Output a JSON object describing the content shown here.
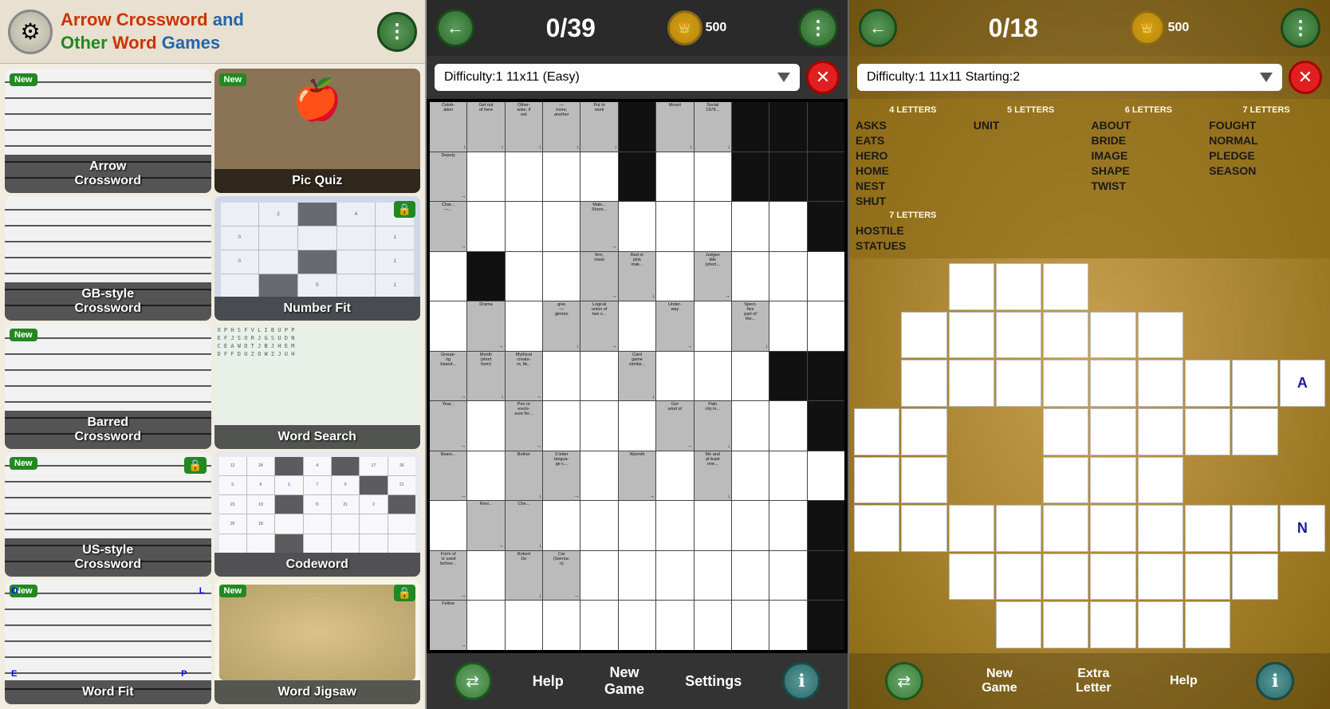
{
  "panel_menu": {
    "header": {
      "title_line1": "Arrow Crossword and",
      "title_line2": "Other Word Games"
    },
    "items": [
      {
        "id": "arrow-crossword",
        "label": "Arrow\nCrossword",
        "label_l1": "Arrow",
        "label_l2": "Crossword",
        "new": true,
        "lock": false,
        "col": 0
      },
      {
        "id": "pic-quiz",
        "label": "Pic Quiz",
        "new": true,
        "lock": false,
        "col": 1
      },
      {
        "id": "gb-crossword",
        "label": "GB-style\nCrossword",
        "label_l1": "GB-style",
        "label_l2": "Crossword",
        "new": false,
        "lock": false,
        "col": 0
      },
      {
        "id": "number-fit",
        "label": "Number Fit",
        "new": false,
        "lock": true,
        "col": 1
      },
      {
        "id": "barred-crossword",
        "label": "Barred\nCrossword",
        "label_l1": "Barred",
        "label_l2": "Crossword",
        "new": true,
        "lock": false,
        "col": 0
      },
      {
        "id": "word-search",
        "label": "Word Search",
        "new": false,
        "lock": false,
        "col": 1
      },
      {
        "id": "us-crossword",
        "label": "US-style\nCrossword",
        "label_l1": "US-style",
        "label_l2": "Crossword",
        "new": true,
        "lock": true,
        "col": 0
      },
      {
        "id": "codeword",
        "label": "Codeword",
        "new": false,
        "lock": false,
        "col": 1
      },
      {
        "id": "word-fit",
        "label": "Word Fit",
        "new": true,
        "lock": false,
        "col": 0
      },
      {
        "id": "word-jigsaw",
        "label": "Word Jigsaw",
        "new": true,
        "lock": true,
        "col": 1
      }
    ]
  },
  "panel_game": {
    "score": "0/39",
    "coins": "500",
    "difficulty": "Difficulty:1  11x11  (Easy)",
    "footer": {
      "help": "Help",
      "new_game": "New\nGame",
      "new_game_l1": "New",
      "new_game_l2": "Game",
      "settings": "Settings"
    },
    "clues": [
      {
        "r": 0,
        "c": 0,
        "text": "Celeb-\nation",
        "arrow": "↓"
      },
      {
        "r": 0,
        "c": 1,
        "text": "Get out\nof here",
        "arrow": "↓"
      },
      {
        "r": 0,
        "c": 2,
        "text": "Other-\nwise, if\nnot",
        "arrow": "↓"
      },
      {
        "r": 0,
        "c": 3,
        "text": "—\nmore,\nanother",
        "arrow": "↓"
      },
      {
        "r": 0,
        "c": 4,
        "text": "Put to\nwork",
        "arrow": "↓"
      },
      {
        "r": 0,
        "c": 6,
        "text": "Mount",
        "arrow": "↓"
      },
      {
        "r": 0,
        "c": 7,
        "text": "Social\n1978...",
        "arrow": "↓"
      },
      {
        "r": 1,
        "c": 0,
        "text": "Deputy",
        "arrow": "→"
      },
      {
        "r": 2,
        "c": 0,
        "text": "Char...",
        "arrow": "→"
      },
      {
        "r": 2,
        "c": 4,
        "text": "Male...\nShore...",
        "arrow": "→"
      },
      {
        "r": 3,
        "c": 4,
        "text": "firm,\ninsist",
        "arrow": "→"
      },
      {
        "r": 3,
        "c": 5,
        "text": "Red or\npink\nmak...",
        "arrow": "↓"
      },
      {
        "r": 3,
        "c": 6,
        "text": "Judges\ntitle\n(short...",
        "arrow": "→"
      },
      {
        "r": 4,
        "c": 1,
        "text": "Drama",
        "arrow": "→"
      },
      {
        "r": 4,
        "c": 3,
        "text": "give\n—\ngimmo",
        "arrow": "↓"
      },
      {
        "r": 4,
        "c": 4,
        "text": "Logical\nunion of\ntwo s...",
        "arrow": "→"
      },
      {
        "r": 4,
        "c": 5,
        "text": "Under-\nway",
        "arrow": "→"
      },
      {
        "r": 4,
        "c": 7,
        "text": "Speci-\nfies\npart of\nthe...",
        "arrow": "↓"
      },
      {
        "r": 5,
        "c": 0,
        "text": "Groupi-\nng\nbased...",
        "arrow": "→"
      },
      {
        "r": 5,
        "c": 1,
        "text": "Month\n(short\nform)",
        "arrow": "↓"
      },
      {
        "r": 5,
        "c": 2,
        "text": "Mythical\ncreatu-\nre, lik...",
        "arrow": "→"
      },
      {
        "r": 5,
        "c": 5,
        "text": "Card\ngame\nsimilar...",
        "arrow": "↓"
      },
      {
        "r": 6,
        "c": 0,
        "text": "Year...",
        "arrow": "→"
      },
      {
        "r": 6,
        "c": 2,
        "text": "Pen or\nenclo-\nsure for...",
        "arrow": "→"
      },
      {
        "r": 6,
        "c": 6,
        "text": "Get\nwind of",
        "arrow": "→"
      },
      {
        "r": 6,
        "c": 7,
        "text": "Palo\ncity in...",
        "arrow": "↓"
      },
      {
        "r": 7,
        "c": 0,
        "text": "Beam...",
        "arrow": "→"
      },
      {
        "r": 7,
        "c": 2,
        "text": "Bother",
        "arrow": "↓"
      },
      {
        "r": 7,
        "c": 3,
        "text": "3 letter\nlangua-\nge c...",
        "arrow": "→"
      },
      {
        "r": 7,
        "c": 5,
        "text": "Warmth",
        "arrow": "→"
      },
      {
        "r": 7,
        "c": 7,
        "text": "Me and\nat least\none...",
        "arrow": "↓"
      },
      {
        "r": 8,
        "c": 0,
        "text": "",
        "arrow": ""
      },
      {
        "r": 9,
        "c": 0,
        "text": "Form of\n'a' used\nbefore...",
        "arrow": "→"
      },
      {
        "r": 9,
        "c": 2,
        "text": "Robert\nDe",
        "arrow": "↓"
      },
      {
        "r": 9,
        "c": 3,
        "text": "Car\n(Germa-\nn)",
        "arrow": "→"
      },
      {
        "r": 10,
        "c": 0,
        "text": "Fellow",
        "arrow": "→"
      },
      {
        "r": 8,
        "c": 1,
        "text": "Resi...",
        "arrow": "→"
      },
      {
        "r": 8,
        "c": 2,
        "text": "Che...",
        "arrow": "↓"
      }
    ]
  },
  "panel_jigsaw": {
    "score": "0/18",
    "coins": "500",
    "difficulty": "Difficulty:1  11x11  Starting:2",
    "word_bank": {
      "col4": {
        "header": "4 LETTERS",
        "words": [
          "ASKS",
          "EATS",
          "HERO",
          "HOME",
          "NEST",
          "SHUT"
        ]
      },
      "col5": {
        "header": "5 LETTERS",
        "words": [
          "UNIT"
        ]
      },
      "col6": {
        "header": "6 LETTERS",
        "words": [
          "ABOUT",
          "BRIDE",
          "IMAGE",
          "SHAPE",
          "TWIST"
        ]
      },
      "col7": {
        "header": "7 LETTERS",
        "words": [
          "FOUGHT",
          "NORMAL",
          "PLEDGE",
          "SEASON"
        ]
      },
      "col8": {
        "header": "7 LETTERS",
        "words": [
          "HOSTILE",
          "STATUES"
        ]
      }
    },
    "grid_letters": {
      "r2c9": "A",
      "r5c9": "N"
    },
    "footer": {
      "new_game_l1": "New",
      "new_game_l2": "Game",
      "extra_letter_l1": "Extra",
      "extra_letter_l2": "Letter",
      "help": "Help"
    }
  }
}
